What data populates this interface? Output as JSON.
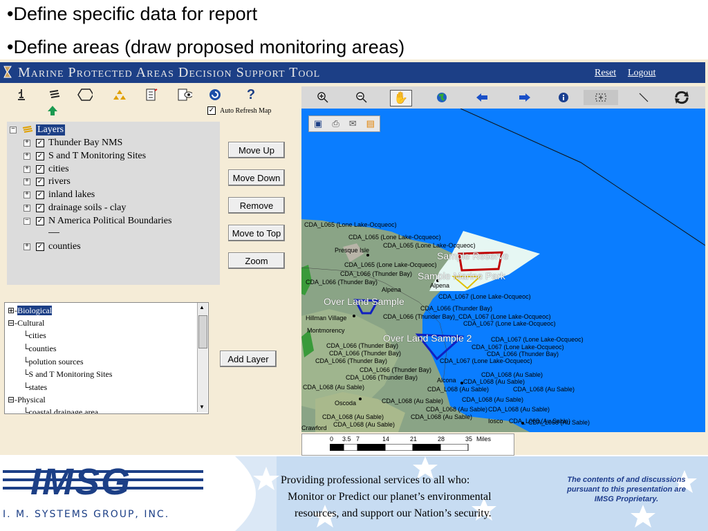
{
  "slide": {
    "bullet1": "•Define specific data for report",
    "bullet2": "•Define areas (draw proposed monitoring areas)"
  },
  "app": {
    "title": "Marine Protected Areas Decision Support Tool",
    "reset": "Reset",
    "logout": "Logout",
    "auto_refresh": "Auto Refresh Map",
    "auto_refresh_checked": true,
    "help_glyph": "?"
  },
  "layers": {
    "root": "Layers",
    "items": [
      {
        "label": "Thunder Bay NMS",
        "checked": true
      },
      {
        "label": "S and T Monitoring Sites",
        "checked": true
      },
      {
        "label": "cities",
        "checked": true
      },
      {
        "label": "rivers",
        "checked": true
      },
      {
        "label": "inland lakes",
        "checked": true
      },
      {
        "label": "drainage soils - clay",
        "checked": true
      },
      {
        "label": "N America Political Boundaries",
        "checked": true
      },
      {
        "label": "counties",
        "checked": true
      }
    ]
  },
  "buttons": {
    "move_up": "Move Up",
    "move_down": "Move Down",
    "remove": "Remove",
    "move_to_top": "Move to Top",
    "zoom": "Zoom",
    "add_layer": "Add Layer"
  },
  "catalog": {
    "biological": "Biological",
    "cultural": "Cultural",
    "cultural_items": [
      "cities",
      "counties",
      "polution sources",
      "S and T Monitoring Sites",
      "states"
    ],
    "physical": "Physical",
    "physical_partial": "coastal drainage area"
  },
  "map": {
    "labels": [
      "CDA_L065 (Lone Lake-Ocqueoc)",
      "CDA_L065 (Lone Lake-Ocqueoc)",
      "CDA_L065 (Lone Lake-Ocqueoc)",
      "Presque Isle",
      "CDA_L065 (Lone Lake-Ocqueoc)",
      "CDA_L066 (Thunder Bay)",
      "CDA_L066 (Thunder Bay)",
      "Alpena",
      "Alpena",
      "CDA_L067 (Lone Lake-Ocqueoc)",
      "CDA_L066 (Thunder Bay)",
      "Hillman Village",
      "CDA_L066 (Thunder Bay)_CDA_L067 (Lone Lake-Ocqueoc)",
      "CDA_L067 (Lone Lake-Ocqueoc)",
      "Montmorency",
      "CDA_L067 (Lone Lake-Ocqueoc)",
      "CDA_L066 (Thunder Bay)",
      "CDA_L067 (Lone Lake-Ocqueoc)",
      "CDA_L066 (Thunder Bay)",
      "CDA_L066 (Thunder Bay)",
      "CDA_L066 (Thunder Bay)",
      "CDA_L067 (Lone Lake-Ocqueoc)",
      "CDA_L066 (Thunder Bay)",
      "CDA_L066 (Thunder Bay)",
      "CDA_L068 (Au Sable)",
      "CDA_L068 (Au Sable)",
      "Alcona",
      "CDA_L068 (Au Sable)",
      "CDA_L068 (Au Sable)",
      "CDA_L068 (Au Sable)",
      "CDA_L068 (Au Sable)",
      "Oscoda",
      "CDA_L068 (Au Sable)",
      "CDA_L068 (Au Sable)",
      "CDA_L068 (Au Sable)",
      "CDA_L068 (Au Sable)",
      "CDA_L068 (Au Sable)",
      "CDA_L068 (Au Sable)",
      "CDA_L068 (Au Sable)",
      "Iosco",
      "CDA_L068 (Au Sable)",
      "Crawford"
    ],
    "area_labels": [
      "Sample Reserve",
      "Sample Marine Park",
      "Over Land Sample",
      "Over Land Sample 2"
    ],
    "scale_ticks": [
      "0",
      "3.5",
      "7",
      "14",
      "21",
      "28",
      "35"
    ],
    "scale_unit": "Miles"
  },
  "footer": {
    "company": "I. M. SYSTEMS GROUP, INC.",
    "logo_text": "IMSG",
    "line1": "Providing professional services to all who:",
    "line2": "Monitor or Predict our planet’s environmental",
    "line3": "resources, and support our Nation’s security.",
    "prop1": "The contents of and discussions",
    "prop2": "pursuant to this presentation are",
    "prop3": "IMSG Proprietary."
  }
}
